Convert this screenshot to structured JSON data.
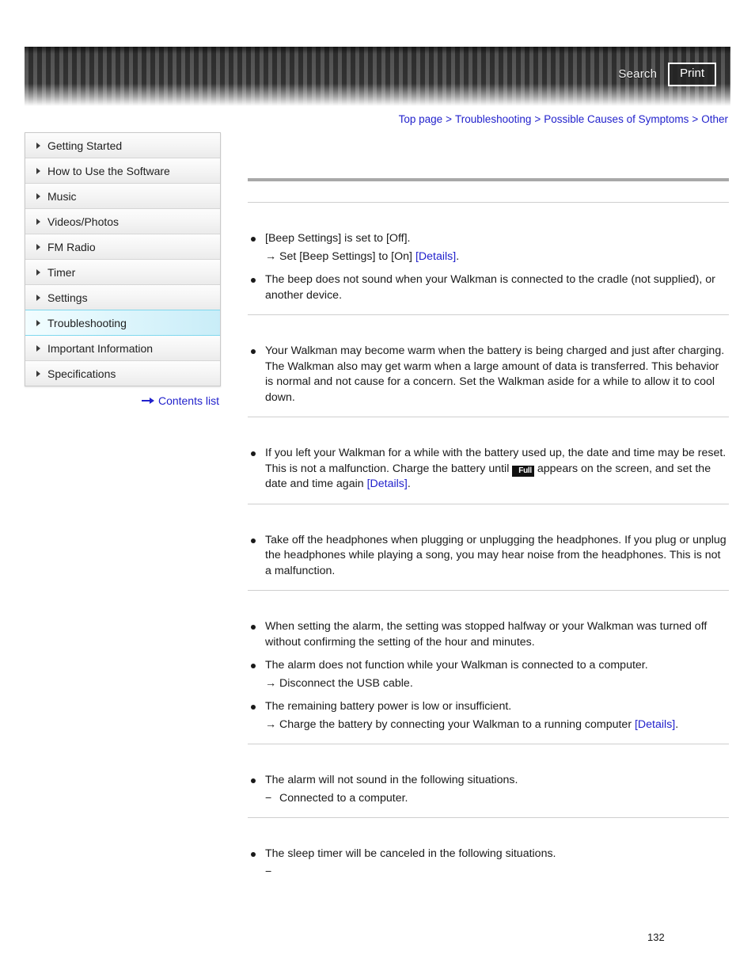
{
  "header": {
    "search_label": "Search",
    "print_label": "Print",
    "search_icon": "search-icon",
    "print_icon": "print-icon"
  },
  "breadcrumb": {
    "separator": ">",
    "items": [
      {
        "label": "Top page"
      },
      {
        "label": "Troubleshooting"
      },
      {
        "label": "Possible Causes of Symptoms"
      },
      {
        "label": "Other"
      }
    ]
  },
  "sidebar": {
    "items": [
      {
        "label": "Getting Started",
        "active": false
      },
      {
        "label": "How to Use the Software",
        "active": false
      },
      {
        "label": "Music",
        "active": false
      },
      {
        "label": "Videos/Photos",
        "active": false
      },
      {
        "label": "FM Radio",
        "active": false
      },
      {
        "label": "Timer",
        "active": false
      },
      {
        "label": "Settings",
        "active": false
      },
      {
        "label": "Troubleshooting",
        "active": true
      },
      {
        "label": "Important Information",
        "active": false
      },
      {
        "label": "Specifications",
        "active": false
      }
    ],
    "contents_list_label": "Contents list",
    "contents_list_icon": "right-arrow-icon"
  },
  "main": {
    "heading": "",
    "subheading": "",
    "sections": [
      {
        "title": "",
        "bullets": [
          {
            "text_parts": [
              {
                "type": "text",
                "value": "[Beep Settings] is set to [Off]."
              }
            ],
            "sub": [
              {
                "glyph": "→",
                "parts": [
                  {
                    "type": "text",
                    "value": "Set [Beep Settings] to [On] "
                  },
                  {
                    "type": "link",
                    "value": "[Details]"
                  },
                  {
                    "type": "text",
                    "value": "."
                  }
                ]
              }
            ]
          },
          {
            "text_parts": [
              {
                "type": "text",
                "value": "The beep does not sound when your Walkman is connected to the cradle (not supplied), or another device."
              }
            ],
            "sub": []
          }
        ]
      },
      {
        "title": "",
        "bullets": [
          {
            "text_parts": [
              {
                "type": "text",
                "value": "Your Walkman may become warm when the battery is being charged and just after charging. The Walkman also may get warm when a large amount of data is transferred. This behavior is normal and not cause for a concern. Set the Walkman aside for a while to allow it to cool down."
              }
            ],
            "sub": []
          }
        ]
      },
      {
        "title": "",
        "bullets": [
          {
            "text_parts": [
              {
                "type": "text",
                "value": "If you left your Walkman for a while with the battery used up, the date and time may be reset. This is not a malfunction. Charge the battery until "
              },
              {
                "type": "icon",
                "value": "Full",
                "icon_name": "battery-full-icon"
              },
              {
                "type": "text",
                "value": " appears on the screen, and set the date and time again "
              },
              {
                "type": "link",
                "value": "[Details]"
              },
              {
                "type": "text",
                "value": "."
              }
            ],
            "sub": []
          }
        ]
      },
      {
        "title": "",
        "bullets": [
          {
            "text_parts": [
              {
                "type": "text",
                "value": "Take off the headphones when plugging or unplugging the headphones. If you plug or unplug the headphones while playing a song, you may hear noise from the headphones. This is not a malfunction."
              }
            ],
            "sub": []
          }
        ]
      },
      {
        "title": "",
        "bullets": [
          {
            "text_parts": [
              {
                "type": "text",
                "value": "When setting the alarm, the setting was stopped halfway or your Walkman was turned off without confirming the setting of the hour and minutes."
              }
            ],
            "sub": []
          },
          {
            "text_parts": [
              {
                "type": "text",
                "value": "The alarm does not function while your Walkman is connected to a computer."
              }
            ],
            "sub": [
              {
                "glyph": "→",
                "parts": [
                  {
                    "type": "text",
                    "value": "Disconnect the USB cable."
                  }
                ]
              }
            ]
          },
          {
            "text_parts": [
              {
                "type": "text",
                "value": "The remaining battery power is low or insufficient."
              }
            ],
            "sub": [
              {
                "glyph": "→",
                "parts": [
                  {
                    "type": "text",
                    "value": "Charge the battery by connecting your Walkman to a running computer "
                  },
                  {
                    "type": "link",
                    "value": "[Details]"
                  },
                  {
                    "type": "text",
                    "value": "."
                  }
                ]
              }
            ]
          }
        ]
      },
      {
        "title": "",
        "bullets": [
          {
            "text_parts": [
              {
                "type": "text",
                "value": "The alarm will not sound in the following situations."
              }
            ],
            "sub": [
              {
                "glyph": "−",
                "parts": [
                  {
                    "type": "text",
                    "value": "Connected to a computer."
                  }
                ]
              }
            ]
          }
        ]
      },
      {
        "title": "",
        "bullets": [
          {
            "text_parts": [
              {
                "type": "text",
                "value": "The sleep timer will be canceled in the following situations."
              }
            ],
            "sub": [
              {
                "glyph": "−",
                "parts": [
                  {
                    "type": "text",
                    "value": ""
                  }
                ]
              }
            ]
          }
        ]
      }
    ]
  },
  "footer": {
    "page_number": "132"
  }
}
